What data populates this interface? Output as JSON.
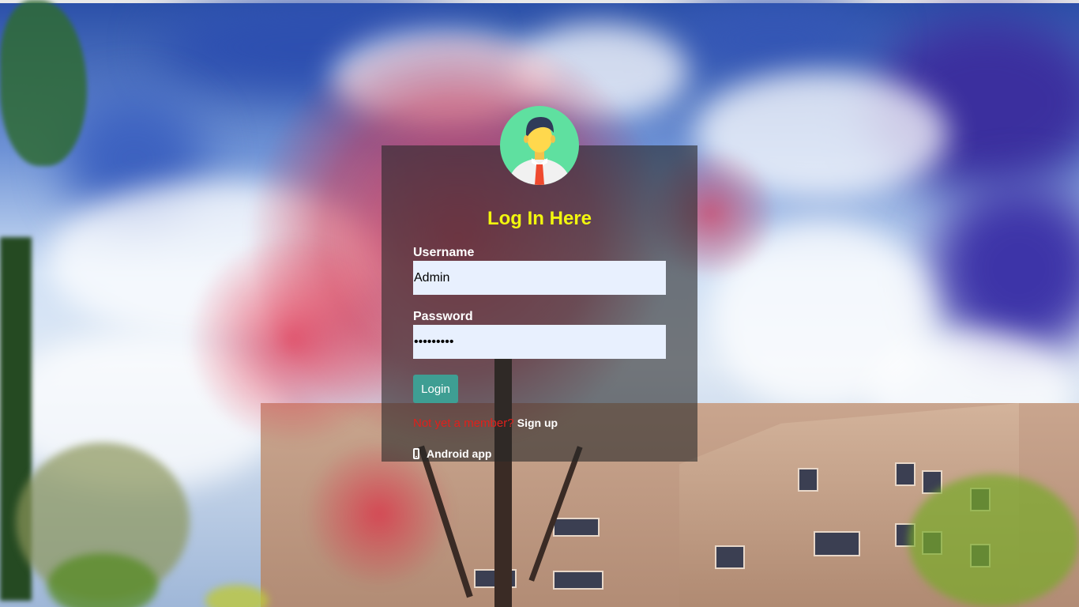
{
  "login": {
    "title": "Log In Here",
    "username_label": "Username",
    "username_value": "Admin",
    "password_label": "Password",
    "password_value": "•••••••••",
    "login_button": "Login",
    "signup_prompt": "Not yet a member?",
    "signup_link": "Sign up",
    "android_link": "Android app"
  },
  "icons": {
    "avatar": "user-avatar-icon",
    "android": "mobile-phone-icon"
  },
  "colors": {
    "title": "#f2f70e",
    "login_button": "#3e9e93",
    "signup_prompt": "#e0201b",
    "input_background": "#e8f0fe"
  }
}
